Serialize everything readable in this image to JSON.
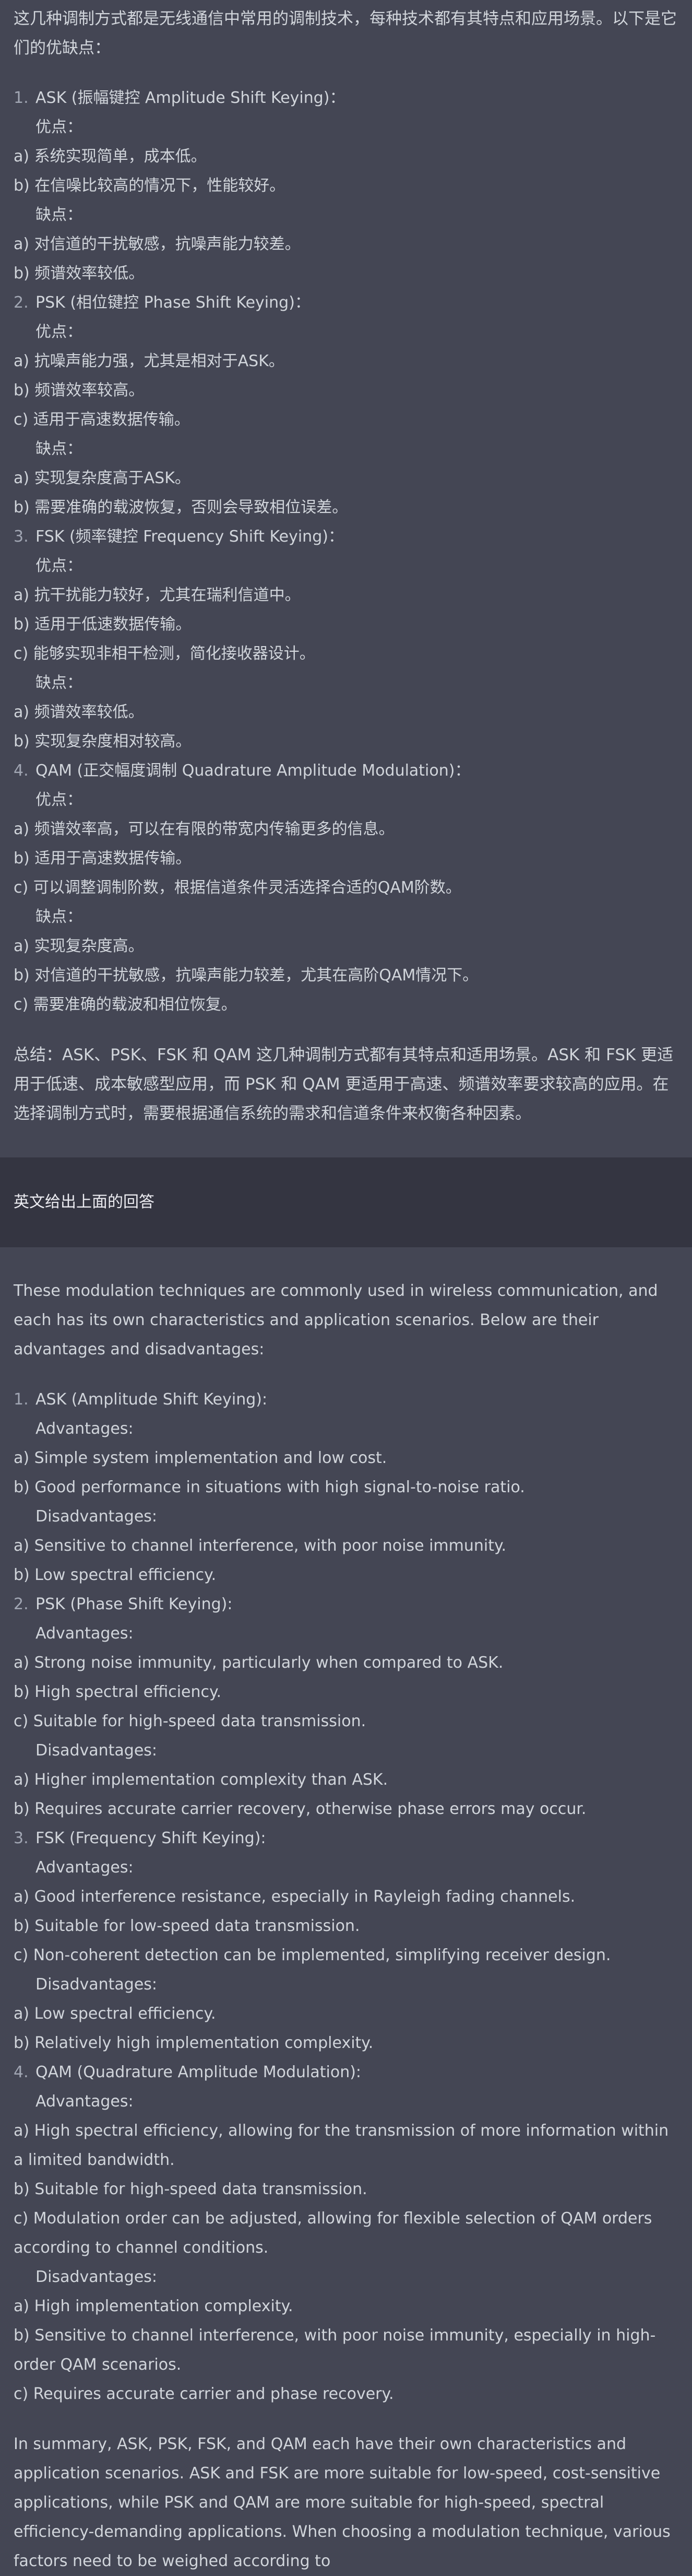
{
  "zh": {
    "intro": "这几种调制方式都是无线通信中常用的调制技术，每种技术都有其特点和应用场景。以下是它们的优缺点：",
    "items": [
      {
        "num": "1.",
        "title": "ASK (振幅键控 Amplitude Shift Keying)：",
        "adv_label": "优点：",
        "advantages": [
          "a) 系统实现简单，成本低。",
          "b) 在信噪比较高的情况下，性能较好。"
        ],
        "dis_label": "缺点：",
        "disadvantages": [
          "a) 对信道的干扰敏感，抗噪声能力较差。",
          "b) 频谱效率较低。"
        ]
      },
      {
        "num": "2.",
        "title": "PSK (相位键控 Phase Shift Keying)：",
        "adv_label": "优点：",
        "advantages": [
          "a) 抗噪声能力强，尤其是相对于ASK。",
          "b) 频谱效率较高。",
          "c) 适用于高速数据传输。"
        ],
        "dis_label": "缺点：",
        "disadvantages": [
          "a) 实现复杂度高于ASK。",
          "b) 需要准确的载波恢复，否则会导致相位误差。"
        ]
      },
      {
        "num": "3.",
        "title": "FSK (频率键控 Frequency Shift Keying)：",
        "adv_label": "优点：",
        "advantages": [
          "a) 抗干扰能力较好，尤其在瑞利信道中。",
          "b) 适用于低速数据传输。",
          "c) 能够实现非相干检测，简化接收器设计。"
        ],
        "dis_label": "缺点：",
        "disadvantages": [
          "a) 频谱效率较低。",
          "b) 实现复杂度相对较高。"
        ]
      },
      {
        "num": "4.",
        "title": "QAM (正交幅度调制 Quadrature Amplitude Modulation)：",
        "adv_label": "优点：",
        "advantages": [
          "a) 频谱效率高，可以在有限的带宽内传输更多的信息。",
          "b) 适用于高速数据传输。",
          "c) 可以调整调制阶数，根据信道条件灵活选择合适的QAM阶数。"
        ],
        "dis_label": "缺点：",
        "disadvantages": [
          "a) 实现复杂度高。",
          "b) 对信道的干扰敏感，抗噪声能力较差，尤其在高阶QAM情况下。",
          "c) 需要准确的载波和相位恢复。"
        ]
      }
    ],
    "summary": "总结：ASK、PSK、FSK 和 QAM 这几种调制方式都有其特点和适用场景。ASK 和 FSK 更适用于低速、成本敏感型应用，而 PSK 和 QAM 更适用于高速、频谱效率要求较高的应用。在选择调制方式时，需要根据通信系统的需求和信道条件来权衡各种因素。"
  },
  "user_message": "英文给出上面的回答",
  "en": {
    "intro": "These modulation techniques are commonly used in wireless communication, and each has its own characteristics and application scenarios. Below are their advantages and disadvantages:",
    "items": [
      {
        "num": "1.",
        "title": "ASK (Amplitude Shift Keying):",
        "adv_label": "Advantages:",
        "advantages": [
          "a) Simple system implementation and low cost.",
          "b) Good performance in situations with high signal-to-noise ratio."
        ],
        "dis_label": "Disadvantages:",
        "disadvantages": [
          "a) Sensitive to channel interference, with poor noise immunity.",
          "b) Low spectral efficiency."
        ]
      },
      {
        "num": "2.",
        "title": "PSK (Phase Shift Keying):",
        "adv_label": "Advantages:",
        "advantages": [
          "a) Strong noise immunity, particularly when compared to ASK.",
          "b) High spectral efficiency.",
          "c) Suitable for high-speed data transmission."
        ],
        "dis_label": "Disadvantages:",
        "disadvantages": [
          "a) Higher implementation complexity than ASK.",
          "b) Requires accurate carrier recovery, otherwise phase errors may occur."
        ]
      },
      {
        "num": "3.",
        "title": "FSK (Frequency Shift Keying):",
        "adv_label": "Advantages:",
        "advantages": [
          "a) Good interference resistance, especially in Rayleigh fading channels.",
          "b) Suitable for low-speed data transmission.",
          "c) Non-coherent detection can be implemented, simplifying receiver design."
        ],
        "dis_label": "Disadvantages:",
        "disadvantages": [
          "a) Low spectral efficiency.",
          "b) Relatively high implementation complexity."
        ]
      },
      {
        "num": "4.",
        "title": "QAM (Quadrature Amplitude Modulation):",
        "adv_label": "Advantages:",
        "advantages": [
          "a) High spectral efficiency, allowing for the transmission of more information within a limited bandwidth.",
          "b) Suitable for high-speed data transmission.",
          "c) Modulation order can be adjusted, allowing for flexible selection of QAM orders according to channel conditions."
        ],
        "dis_label": "Disadvantages:",
        "disadvantages": [
          "a) High implementation complexity.",
          "b) Sensitive to channel interference, with poor noise immunity, especially in high-order QAM scenarios.",
          "c) Requires accurate carrier and phase recovery."
        ]
      }
    ],
    "summary": "In summary, ASK, PSK, FSK, and QAM each have their own characteristics and application scenarios. ASK and FSK are more suitable for low-speed, cost-sensitive applications, while PSK and QAM are more suitable for high-speed, spectral efficiency-demanding applications. When choosing a modulation technique, various factors need to be weighed according to"
  }
}
